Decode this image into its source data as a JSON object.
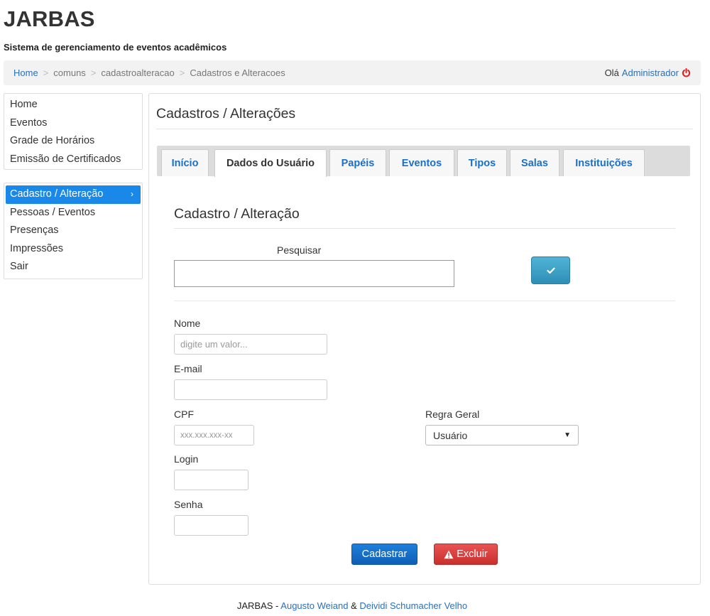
{
  "header": {
    "title": "JARBAS",
    "subtitle": "Sistema de gerenciamento de eventos acadêmicos"
  },
  "breadcrumb": {
    "items": [
      "Home",
      "comuns",
      "cadastroalteracao",
      "Cadastros e Alteracoes"
    ],
    "greeting": "Olá",
    "user": "Administrador"
  },
  "sidebar": {
    "top_items": [
      {
        "label": "Home"
      },
      {
        "label": "Eventos"
      },
      {
        "label": "Grade de Horários"
      },
      {
        "label": "Emissão de Certificados"
      }
    ],
    "bottom_items": [
      {
        "label": "Cadastro / Alteração",
        "active": true
      },
      {
        "label": "Pessoas / Eventos"
      },
      {
        "label": "Presenças"
      },
      {
        "label": "Impressões"
      },
      {
        "label": "Sair"
      }
    ]
  },
  "main": {
    "title": "Cadastros / Alterações",
    "tabs": [
      {
        "label": "Início"
      },
      {
        "label": "Dados do Usuário",
        "active": true
      },
      {
        "label": "Papéis"
      },
      {
        "label": "Eventos"
      },
      {
        "label": "Tipos"
      },
      {
        "label": "Salas"
      },
      {
        "label": "Instituições"
      }
    ],
    "section_title": "Cadastro / Alteração",
    "search": {
      "label": "Pesquisar",
      "value": ""
    },
    "form": {
      "nome_label": "Nome",
      "nome_placeholder": "digite um valor...",
      "email_label": "E-mail",
      "cpf_label": "CPF",
      "cpf_placeholder": "xxx.xxx.xxx-xx",
      "login_label": "Login",
      "senha_label": "Senha",
      "regra_label": "Regra Geral",
      "regra_value": "Usuário"
    },
    "buttons": {
      "submit": "Cadastrar",
      "delete": "Excluir"
    }
  },
  "footer": {
    "prefix": "JARBAS - ",
    "author1": "Augusto Weiand",
    "joiner": " & ",
    "author2": "Deividi Schumacher Velho"
  },
  "colors": {
    "accent": "#1a88e8",
    "link": "#2a6fbb",
    "danger": "#d9534f",
    "info": "#39a0c8"
  }
}
